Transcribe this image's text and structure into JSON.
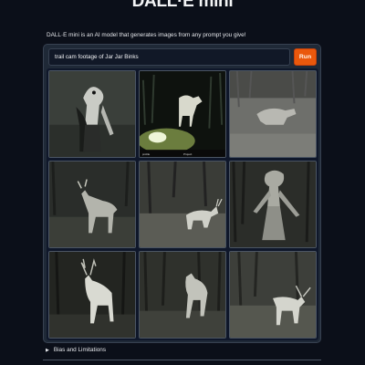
{
  "header": {
    "title": "DALL·E mini",
    "subtitle": "DALL·E mini is an AI model that generates images from any prompt you give!"
  },
  "prompt": {
    "value": "trail cam footage of Jar Jar Binks",
    "run_label": "Run"
  },
  "gallery": {
    "images": [
      {
        "subject": "humanoid-figure"
      },
      {
        "subject": "deer",
        "caption_left": "profile",
        "caption_right": "Project"
      },
      {
        "subject": "animal-blur"
      },
      {
        "subject": "deer"
      },
      {
        "subject": "deer"
      },
      {
        "subject": "humanoid-figure"
      },
      {
        "subject": "deer"
      },
      {
        "subject": "deer"
      },
      {
        "subject": "deer"
      }
    ]
  },
  "accordion": {
    "label": "Bias and Limitations",
    "expanded": false
  },
  "colors": {
    "background": "#0b0f19",
    "panel": "#1f2937",
    "accent": "#ea580c"
  }
}
